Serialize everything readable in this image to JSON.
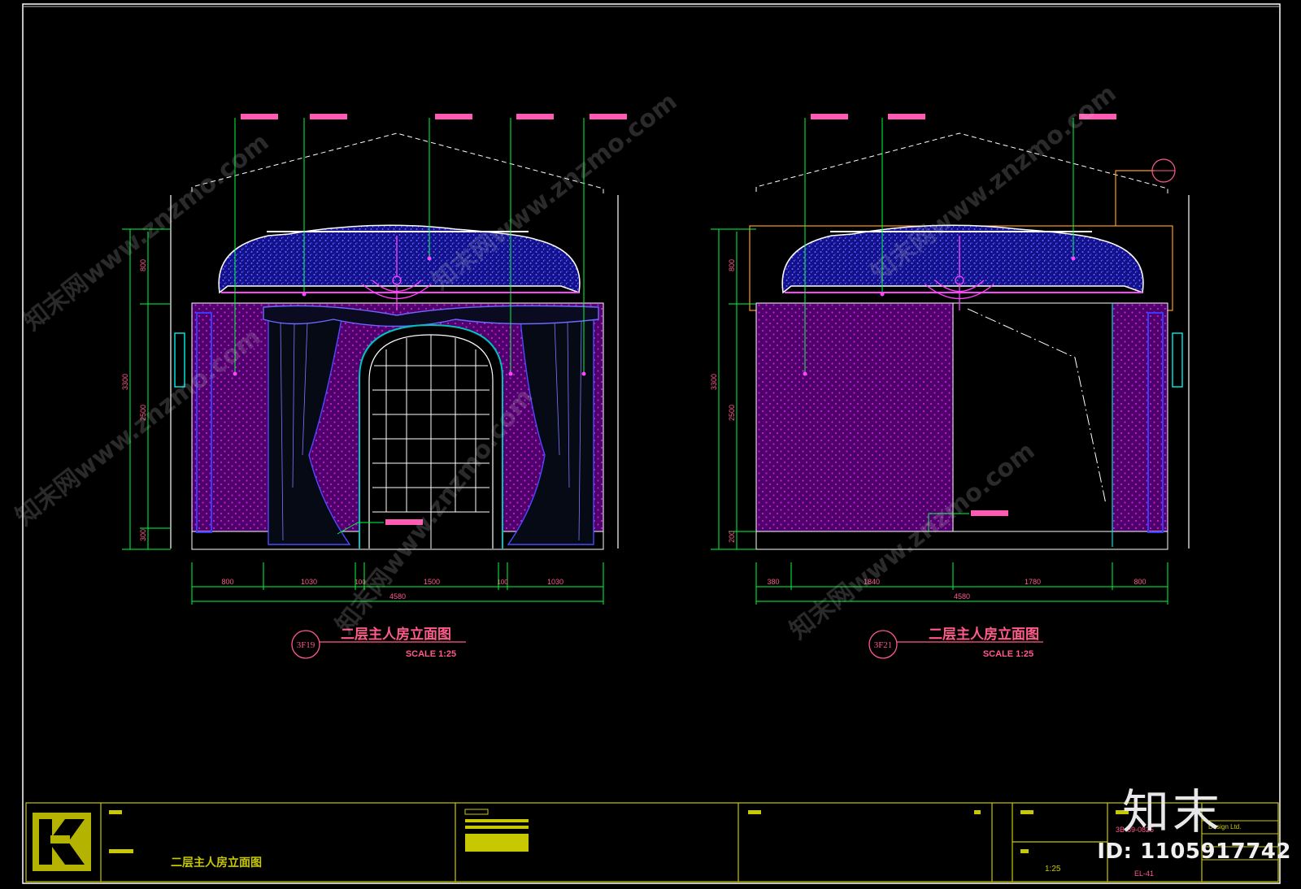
{
  "drawing": {
    "left_view": {
      "tag": "3F19",
      "title": "二层主人房立面图",
      "scale": "SCALE 1:25",
      "height_dims": [
        "800",
        "2500",
        "300",
        "3300"
      ],
      "width_dims": [
        "800",
        "1030",
        "100",
        "1500",
        "100",
        "1030"
      ],
      "total_width": "4580"
    },
    "right_view": {
      "tag": "3F21",
      "title": "二层主人房立面图",
      "scale": "SCALE 1:25",
      "height_dims": [
        "800",
        "2500",
        "200",
        "3300"
      ],
      "width_dims": [
        "380",
        "1840",
        "1780",
        "800"
      ],
      "total_width": "4580"
    },
    "title_block": {
      "drawing_name": "二层主人房立面图",
      "scale": "1:25",
      "code": "3B-89-0825",
      "sheet": "EL-41",
      "company": "Design Ltd."
    }
  },
  "watermarks": {
    "site": "知末网www.znzmo.com",
    "brand": "知末",
    "id": "ID: 1105917742"
  },
  "colors": {
    "background": "#000000",
    "frame": "#ffffff",
    "leader": "#00ff3c",
    "dimension": "#00ff3c",
    "wall_fill": "#5a0070",
    "ceiling_fill": "#1a128c",
    "title": "#ff5a8a",
    "title_block": "#c8c800"
  }
}
